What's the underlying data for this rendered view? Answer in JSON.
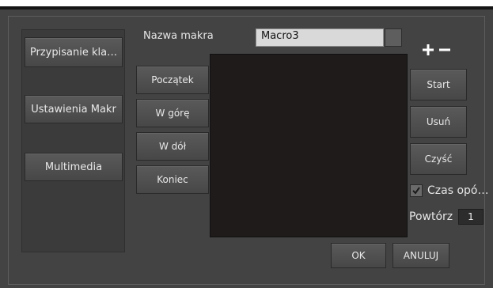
{
  "left_panel": {
    "items": [
      {
        "label": "Przypisanie kla…"
      },
      {
        "label": "Ustawienia Makr"
      },
      {
        "label": "Multimedia"
      }
    ]
  },
  "macro": {
    "name_label": "Nazwa makra",
    "name_value": "Macro3"
  },
  "nav_buttons": {
    "start": "Początek",
    "up": "W górę",
    "down": "W dół",
    "end": "Koniec"
  },
  "right_buttons": {
    "start": "Start",
    "delete": "Usuń",
    "clear": "Czyść"
  },
  "delay": {
    "label": "Czas opó…",
    "checked": true
  },
  "repeat": {
    "label": "Powtórz",
    "value": "1"
  },
  "footer": {
    "ok": "OK",
    "cancel": "ANULUJ"
  },
  "icons": {
    "add": "plus-icon",
    "remove": "minus-icon"
  },
  "colors": {
    "background": "#434343",
    "list_bg": "#1f1b1b",
    "text": "#e8e8e8"
  }
}
